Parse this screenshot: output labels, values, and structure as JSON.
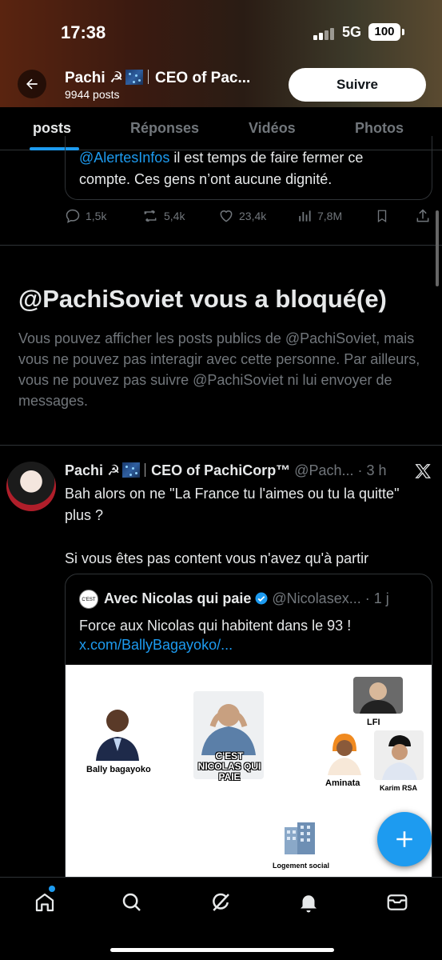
{
  "status_bar": {
    "time": "17:38",
    "network": "5G",
    "battery": "100"
  },
  "header": {
    "name": "Pachi ☭",
    "bio_title": "CEO of Pac...",
    "posts_count": "9944 posts",
    "follow_label": "Suivre"
  },
  "tabs": [
    {
      "label": "posts",
      "active": true
    },
    {
      "label": "Réponses",
      "active": false
    },
    {
      "label": "Vidéos",
      "active": false
    },
    {
      "label": "Photos",
      "active": false
    }
  ],
  "partial_tweet": {
    "mention": "@AlertesInfos",
    "text_rest": " il est temps de faire fermer ce compte. Ces gens n’ont aucune dignité.",
    "replies": "1,5k",
    "reposts": "5,4k",
    "likes": "23,4k",
    "views": "7,8M"
  },
  "blocked": {
    "title": "@PachiSoviet vous a bloqué(e)",
    "description": "Vous pouvez afficher les posts publics de @PachiSoviet, mais vous ne pouvez pas interagir avec cette personne. Par ailleurs, vous ne pouvez pas suivre @PachiSoviet ni lui envoyer de messages."
  },
  "tweet": {
    "name": "Pachi ☭",
    "title": "CEO of PachiCorp™",
    "handle": "@Pach...",
    "time": "· 3 h",
    "line1": "Bah alors on ne \"La France tu l'aimes ou tu la quitte\" plus ?",
    "line2": "Si vous êtes pas content vous n'avez qu'à partir"
  },
  "quote": {
    "name": "Avec Nicolas qui paie",
    "handle": "@Nicolasex...",
    "time": "· 1 j",
    "text": "Force aux Nicolas qui habitent dans le 93 !",
    "link": "x.com/BallyBagayoko/...",
    "avatar_text": "C'EST NICOLAS",
    "image": {
      "label_bally": "Bally bagayoko",
      "label_nicolas": "C'EST NICOLAS QUI PAIE",
      "label_lfi": "LFI",
      "label_aminata": "Aminata",
      "label_karim": "Karim RSA",
      "label_logement": "Logement social"
    }
  },
  "colors": {
    "accent": "#1d9bf0",
    "background": "#000000",
    "muted": "#71767b"
  }
}
